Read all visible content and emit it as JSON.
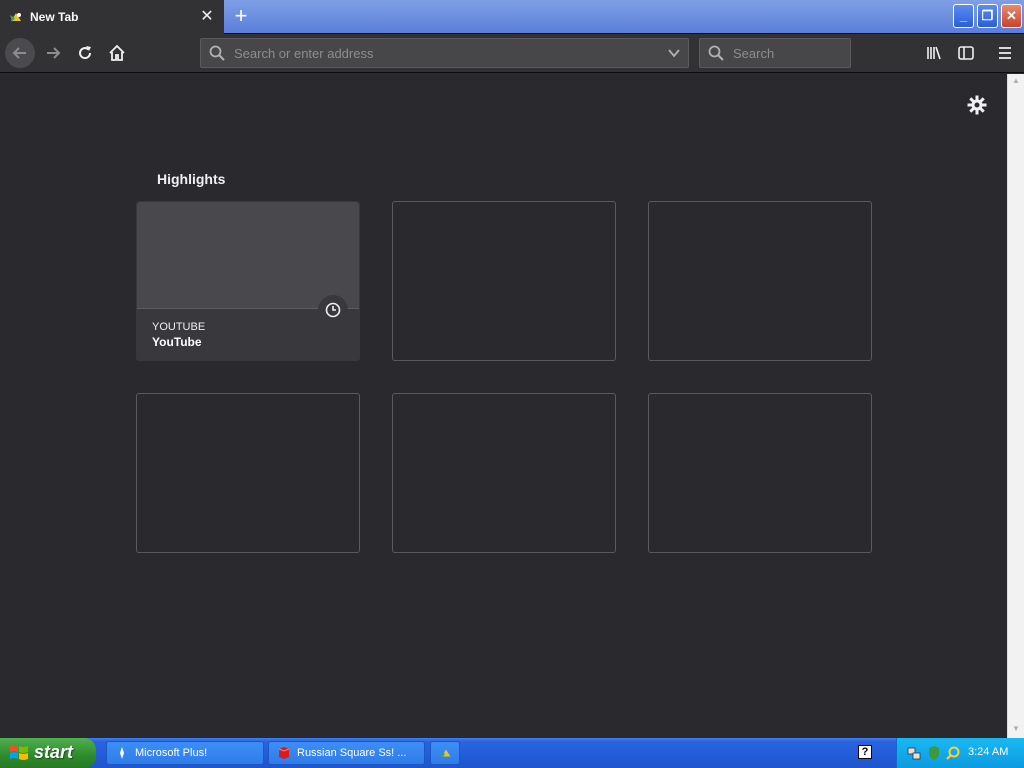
{
  "browser": {
    "tab_title": "New Tab",
    "tab_close": "✕",
    "new_tab": "+",
    "url_placeholder": "Search or enter address",
    "search_placeholder": "Search"
  },
  "window_controls": {
    "minimize": "_",
    "restore": "❐",
    "close": "✕"
  },
  "content": {
    "section_title": "Highlights",
    "cards": [
      {
        "host": "YOUTUBE",
        "title": "YouTube"
      }
    ]
  },
  "taskbar": {
    "start_label": "start",
    "tasks": [
      {
        "label": "Microsoft Plus!"
      },
      {
        "label": "Russian Square Ss! ..."
      }
    ],
    "help": "?",
    "clock": "3:24 AM"
  },
  "colors": {
    "browser_chrome": "#323234",
    "content_bg": "#2a2a2e",
    "card_border": "#5a5a5e",
    "taskbar_blue": "#245edb",
    "start_green": "#2e8a2c",
    "tray_blue": "#0c9be0"
  }
}
